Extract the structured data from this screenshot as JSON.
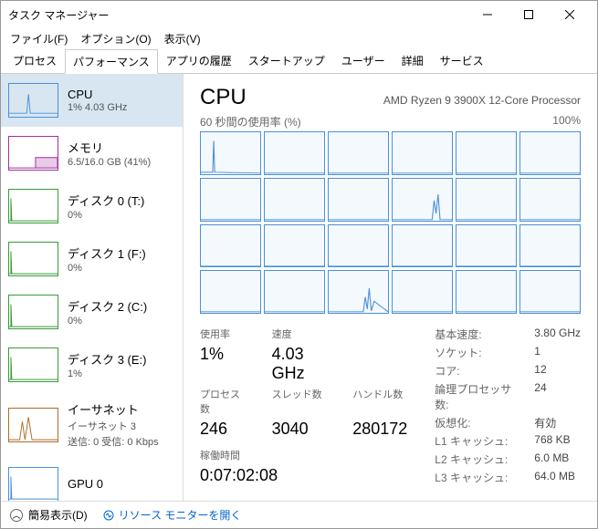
{
  "window": {
    "title": "タスク マネージャー"
  },
  "menu": {
    "file": "ファイル(F)",
    "options": "オプション(O)",
    "view": "表示(V)"
  },
  "tabs": [
    "プロセス",
    "パフォーマンス",
    "アプリの履歴",
    "スタートアップ",
    "ユーザー",
    "詳細",
    "サービス"
  ],
  "active_tab": 1,
  "sidebar": [
    {
      "name": "CPU",
      "sub": "1%  4.03 GHz",
      "color": "#4a90d9",
      "sel": true
    },
    {
      "name": "メモリ",
      "sub": "6.5/16.0 GB (41%)",
      "color": "#a030a0"
    },
    {
      "name": "ディスク 0 (T:)",
      "sub": "0%",
      "color": "#3a9a3a"
    },
    {
      "name": "ディスク 1 (F:)",
      "sub": "0%",
      "color": "#3a9a3a"
    },
    {
      "name": "ディスク 2 (C:)",
      "sub": "0%",
      "color": "#3a9a3a"
    },
    {
      "name": "ディスク 3 (E:)",
      "sub": "1%",
      "color": "#3a9a3a"
    },
    {
      "name": "イーサネット",
      "sub": "イーサネット 3",
      "sub2": "送信: 0 受信: 0 Kbps",
      "color": "#b06a2a"
    },
    {
      "name": "GPU 0",
      "sub": "",
      "color": "#4a90d9"
    }
  ],
  "main": {
    "title": "CPU",
    "model": "AMD Ryzen 9 3900X 12-Core Processor",
    "chart_top_left": "60 秒間の使用率 (%)",
    "chart_top_right": "100%",
    "stats_left": [
      {
        "lbl": "使用率",
        "val": "1%"
      },
      {
        "lbl": "速度",
        "val": "4.03 GHz"
      },
      {
        "lbl": "",
        "val": ""
      },
      {
        "lbl": "プロセス数",
        "val": "246"
      },
      {
        "lbl": "スレッド数",
        "val": "3040"
      },
      {
        "lbl": "ハンドル数",
        "val": "280172"
      }
    ],
    "uptime_lbl": "稼働時間",
    "uptime_val": "0:07:02:08",
    "stats_right": [
      {
        "lbl": "基本速度:",
        "val": "3.80 GHz"
      },
      {
        "lbl": "ソケット:",
        "val": "1"
      },
      {
        "lbl": "コア:",
        "val": "12"
      },
      {
        "lbl": "論理プロセッサ数:",
        "val": "24"
      },
      {
        "lbl": "仮想化:",
        "val": "有効"
      },
      {
        "lbl": "L1 キャッシュ:",
        "val": "768 KB"
      },
      {
        "lbl": "L2 キャッシュ:",
        "val": "6.0 MB"
      },
      {
        "lbl": "L3 キャッシュ:",
        "val": "64.0 MB"
      }
    ]
  },
  "footer": {
    "collapse": "簡易表示(D)",
    "link": "リソース モニターを開く"
  },
  "chart_data": {
    "type": "line",
    "title": "Per-core CPU utilization",
    "ylabel": "%",
    "ylim": [
      0,
      100
    ],
    "series_count": 24,
    "note": "24 logical processors, each showing ~0-5% with occasional spikes up to ~50% on a few cores over 60s window"
  }
}
